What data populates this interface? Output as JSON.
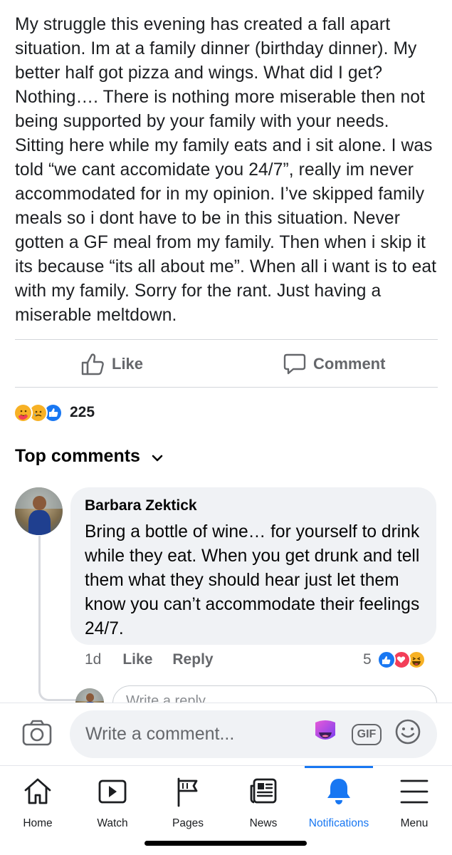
{
  "post": {
    "text": "My struggle this evening has created a fall apart situation. Im at a family dinner (birthday dinner). My better half got pizza and wings. What did I get? Nothing…. There is nothing more miserable then not being supported by your family with your needs. Sitting here while my family eats and i sit alone. I was told “we cant accomidate you 24/7”, really im never accommodated for in my opinion. I’ve skipped family meals so i dont have to be in this situation. Never gotten a GF meal from my family. Then when i skip it its because “its all about me”. When all i want is to eat with my family. Sorry for the rant. Just having a miserable meltdown."
  },
  "actions": {
    "like_label": "Like",
    "comment_label": "Comment"
  },
  "reactions": {
    "icons": [
      "care-icon",
      "sad-icon",
      "like-icon"
    ],
    "count": "225"
  },
  "comments_header": {
    "label": "Top comments"
  },
  "comment": {
    "author": "Barbara Zektick",
    "text": "Bring a bottle of wine… for yourself to drink while they eat. When you get drunk and tell them what they should hear just let them know you can’t accommodate their feelings 24/7.",
    "time": "1d",
    "like_label": "Like",
    "reply_label": "Reply",
    "reaction_count": "5",
    "reaction_icons": [
      "like-icon",
      "love-icon",
      "haha-icon"
    ]
  },
  "reply_box": {
    "placeholder": "Write a reply..."
  },
  "composer": {
    "placeholder": "Write a comment...",
    "gif_label": "GIF"
  },
  "nav": {
    "items": [
      {
        "label": "Home",
        "icon": "home-icon"
      },
      {
        "label": "Watch",
        "icon": "watch-icon"
      },
      {
        "label": "Pages",
        "icon": "flag-icon"
      },
      {
        "label": "News",
        "icon": "news-icon"
      },
      {
        "label": "Notifications",
        "icon": "bell-icon",
        "active": true
      },
      {
        "label": "Menu",
        "icon": "menu-icon"
      }
    ]
  },
  "colors": {
    "accent": "#1877f2",
    "secondary_text": "#65676b",
    "bubble": "#f0f2f5"
  }
}
